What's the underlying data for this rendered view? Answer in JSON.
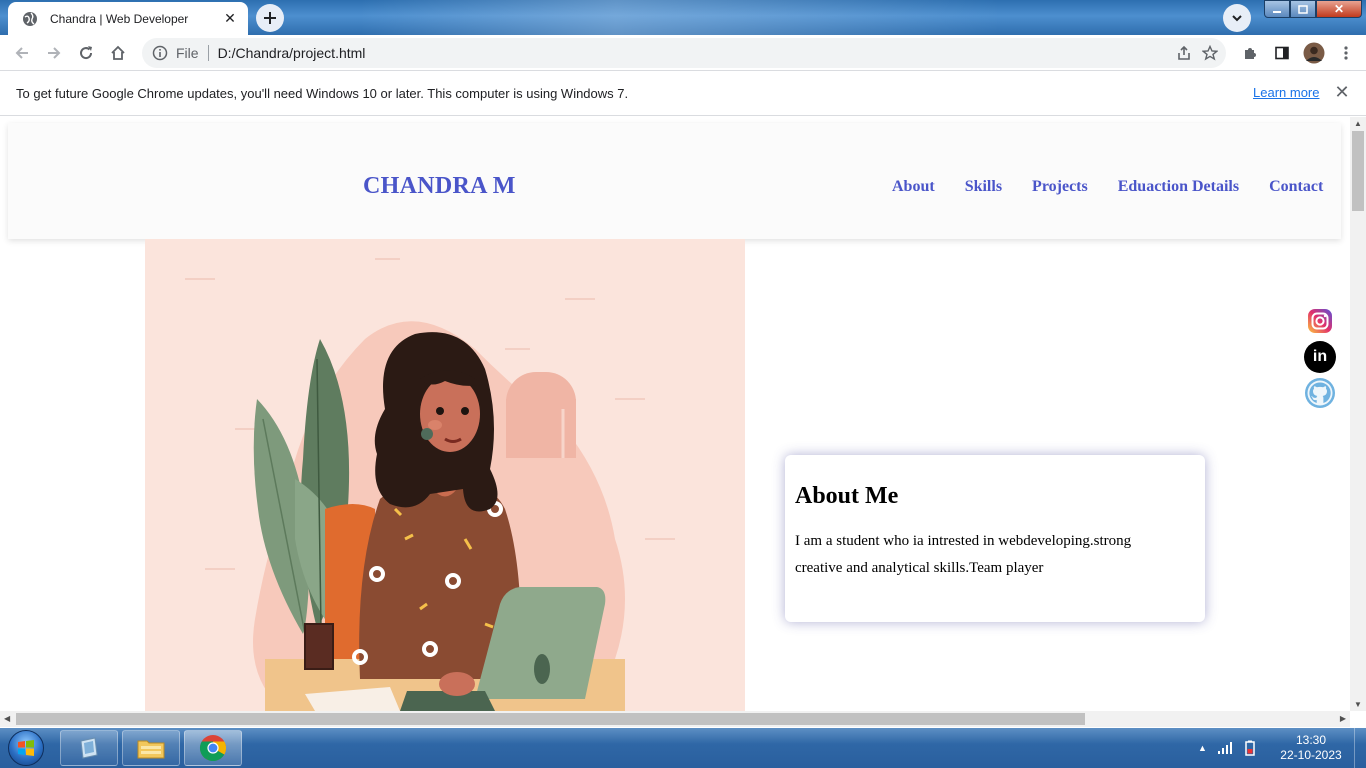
{
  "browser": {
    "tab_title": "Chandra | Web Developer",
    "omnibox_scheme": "File",
    "url": "D:/Chandra/project.html"
  },
  "infobar": {
    "message": "To get future Google Chrome updates, you'll need Windows 10 or later. This computer is using Windows 7.",
    "link": "Learn more"
  },
  "site": {
    "brand": "CHANDRA M",
    "nav": [
      "About",
      "Skills",
      "Projects",
      "Eduaction Details",
      "Contact"
    ],
    "about": {
      "heading": "About Me",
      "text": "I am a student who ia intrested in webdeveloping.strong creative and analytical skills.Team player"
    },
    "social_icons": [
      "instagram-icon",
      "linkedin-icon",
      "github-icon"
    ],
    "accent_color": "#4a55c9"
  },
  "taskbar": {
    "time": "13:30",
    "date": "22-10-2023",
    "pinned": [
      "media-player-icon",
      "file-explorer-icon",
      "chrome-icon"
    ]
  }
}
